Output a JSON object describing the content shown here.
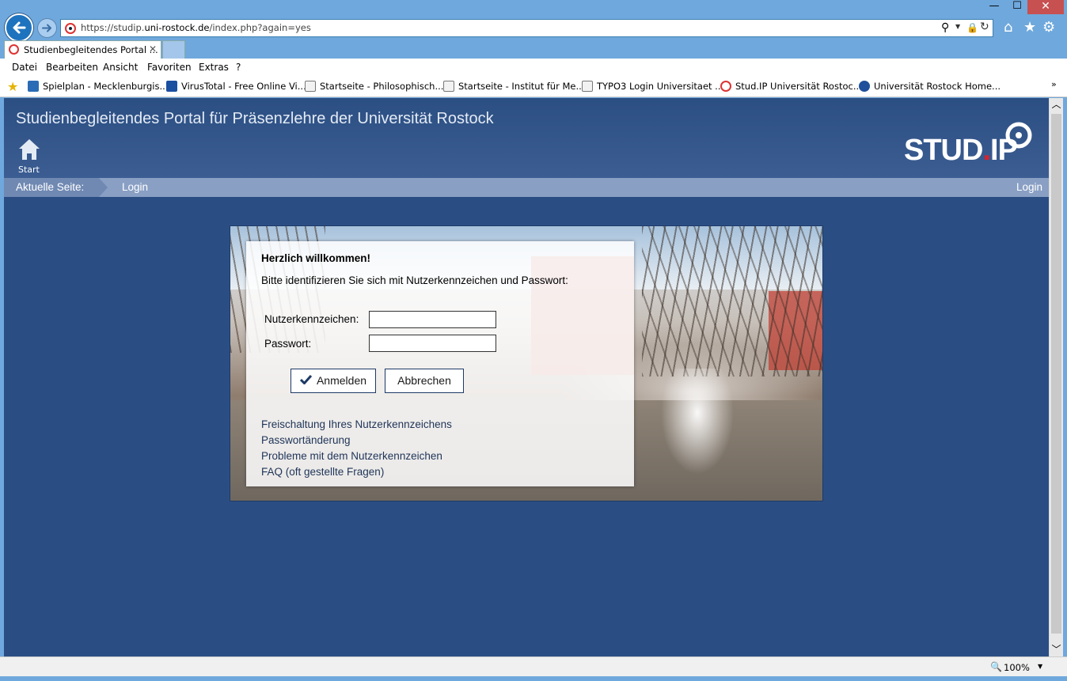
{
  "window": {
    "minimize": "—",
    "maximize": "☐",
    "close": "✕"
  },
  "address": {
    "url_prefix": "https://studip.",
    "url_domain": "uni-rostock.de",
    "url_path": "/index.php?again=yes"
  },
  "tab": {
    "title": "Studienbegleitendes Portal ...",
    "close": "✕"
  },
  "menu": [
    "Datei",
    "Bearbeiten",
    "Ansicht",
    "Favoriten",
    "Extras",
    "?"
  ],
  "favorites": [
    "Spielplan - Mecklenburgis...",
    "VirusTotal - Free Online Vi...",
    "Startseite - Philosophisch...",
    "Startseite - Institut für Me...",
    "TYPO3 Login Universitaet ...",
    "Stud.IP Universität Rostoc...",
    "Universität Rostock Home..."
  ],
  "favorites_more": "»",
  "page": {
    "portal_title": "Studienbegleitendes Portal für Präsenzlehre der Universität Rostock",
    "start_label": "Start",
    "logo_text": "STUD",
    "logo_dot": ".",
    "logo_ip": "IP",
    "breadcrumb_label": "Aktuelle Seite:",
    "breadcrumb_current": "Login",
    "breadcrumb_right": "Login"
  },
  "login": {
    "welcome": "Herzlich willkommen!",
    "instruction": "Bitte identifizieren Sie sich mit Nutzerkennzeichen und Passwort:",
    "user_label": "Nutzerkennzeichen:",
    "pass_label": "Passwort:",
    "user_value": "",
    "pass_value": "",
    "login_button": "Anmelden",
    "cancel_button": "Abbrechen",
    "links": [
      "Freischaltung Ihres Nutzerkennzeichens",
      "Passwortänderung",
      "Probleme mit dem Nutzerkennzeichen",
      "FAQ (oft gestellte Fragen)"
    ]
  },
  "status": {
    "zoom": "100%"
  },
  "colors": {
    "page_background": "#2a4e84",
    "breadcrumb_bar": "#899fc4",
    "logo_dot": "#d8222b",
    "chrome": "#6fa8dc"
  }
}
